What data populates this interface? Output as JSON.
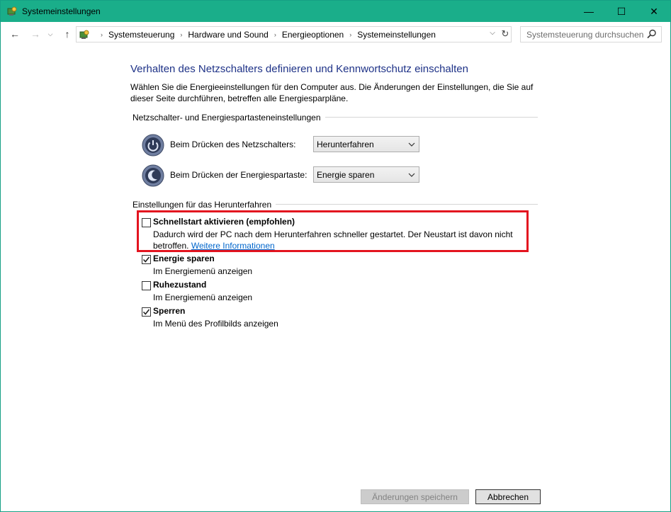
{
  "window": {
    "title": "Systemeinstellungen",
    "accent_color": "#1aae8a",
    "controls": {
      "minimize": "—",
      "maximize": "☐",
      "close": "✕"
    }
  },
  "nav": {
    "back_icon": "←",
    "forward_icon": "→",
    "history_icon": "⌵",
    "up_icon": "↑",
    "breadcrumbs": [
      "Systemsteuerung",
      "Hardware und Sound",
      "Energieoptionen",
      "Systemeinstellungen"
    ],
    "separator": "›",
    "dropdown_icon": "⌵",
    "refresh_icon": "↻",
    "search_placeholder": "Systemsteuerung durchsuchen"
  },
  "main": {
    "heading": "Verhalten des Netzschalters definieren und Kennwortschutz einschalten",
    "intro": "Wählen Sie die Energieeinstellungen für den Computer aus. Die Änderungen der Einstellungen, die Sie auf dieser Seite durchführen, betreffen alle Energiesparpläne.",
    "power_group_title": "Netzschalter- und Energiespartasteneinstellungen",
    "power_button_label": "Beim Drücken des Netzschalters:",
    "power_button_value": "Herunterfahren",
    "sleep_button_label": "Beim Drücken der Energiespartaste:",
    "sleep_button_value": "Energie sparen",
    "shutdown_group_title": "Einstellungen für das Herunterfahren",
    "options": [
      {
        "title": "Schnellstart aktivieren (empfohlen)",
        "desc": "Dadurch wird der PC nach dem Herunterfahren schneller gestartet. Der Neustart ist davon nicht betroffen.",
        "link": "Weitere Informationen",
        "checked": false
      },
      {
        "title": "Energie sparen",
        "desc": "Im Energiemenü anzeigen",
        "checked": true
      },
      {
        "title": "Ruhezustand",
        "desc": "Im Energiemenü anzeigen",
        "checked": false
      },
      {
        "title": "Sperren",
        "desc": "Im Menü des Profilbilds anzeigen",
        "checked": true
      }
    ],
    "highlight_color": "#e3141f"
  },
  "footer": {
    "save_label": "Änderungen speichern",
    "cancel_label": "Abbrechen"
  }
}
